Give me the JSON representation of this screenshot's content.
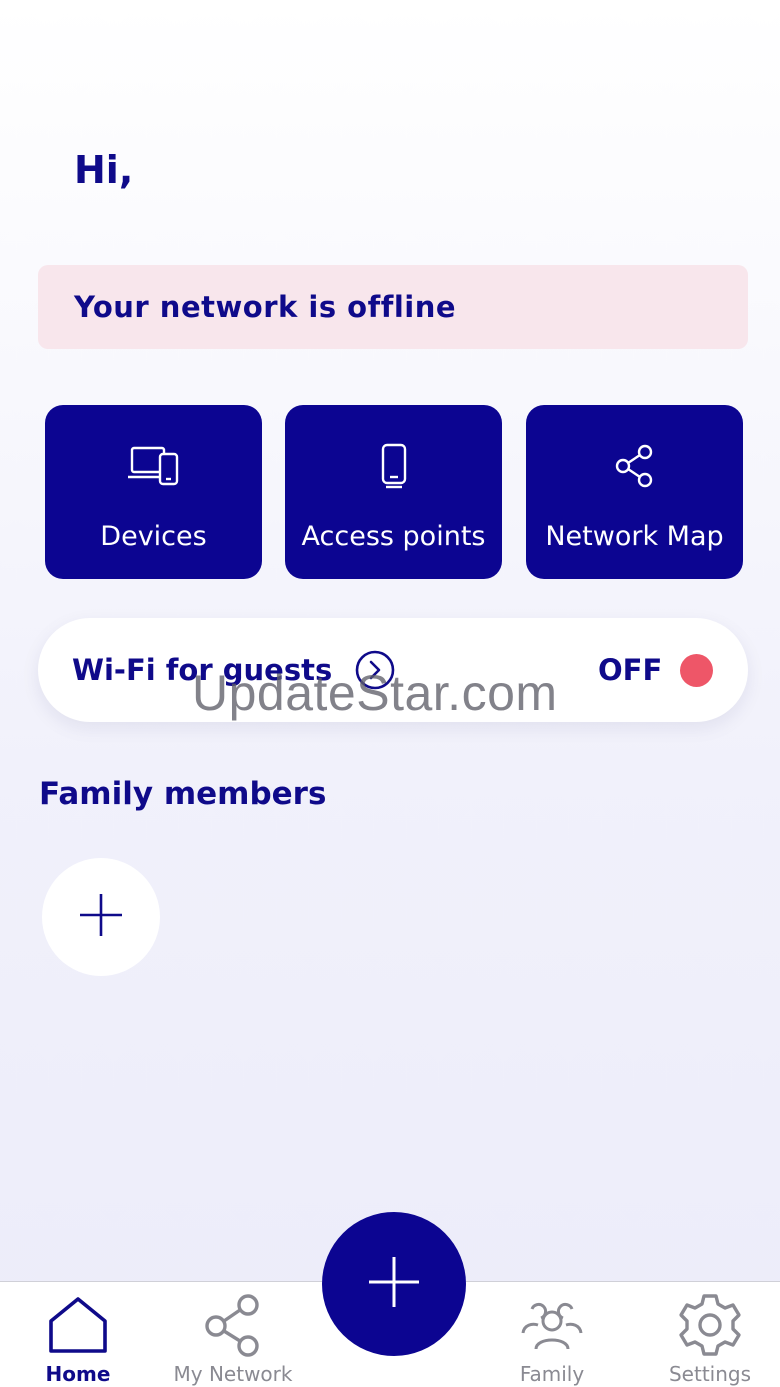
{
  "header": {
    "greeting": "Hi,"
  },
  "alert": {
    "text": "Your network is offline"
  },
  "tiles": [
    {
      "label": "Devices",
      "icon": "devices-icon"
    },
    {
      "label": "Access points",
      "icon": "phone-icon"
    },
    {
      "label": "Network Map",
      "icon": "share-icon"
    }
  ],
  "guest_wifi": {
    "label": "Wi-Fi for guests",
    "state": "OFF",
    "state_color": "#ee5668"
  },
  "watermark": "UpdateStar.com",
  "family": {
    "title": "Family members",
    "add_icon": "plus-icon"
  },
  "tabbar": {
    "items": [
      {
        "label": "Home",
        "icon": "home-icon",
        "active": true
      },
      {
        "label": "My Network",
        "icon": "share-icon",
        "active": false
      },
      {
        "label": "Family",
        "icon": "family-icon",
        "active": false
      },
      {
        "label": "Settings",
        "icon": "gear-icon",
        "active": false
      }
    ],
    "fab_icon": "plus-icon"
  },
  "colors": {
    "brand": "#0c0591",
    "text": "#0f0a8a",
    "alert_bg": "#f8e6ec",
    "muted": "#8a8a92"
  }
}
